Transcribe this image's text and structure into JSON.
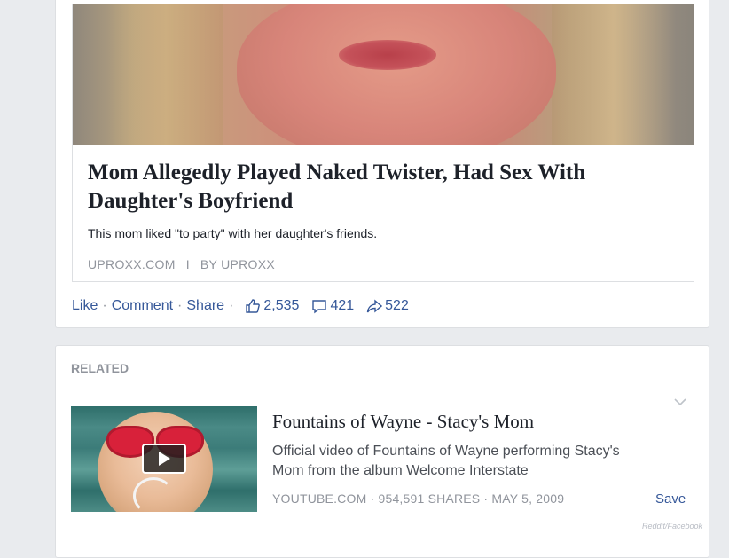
{
  "post": {
    "link_title": "Mom Allegedly Played Naked Twister, Had Sex With Daughter's Boyfriend",
    "link_description": "This mom liked \"to party\" with her daughter's friends.",
    "source_domain": "UPROXX.COM",
    "source_separator": "I",
    "source_author": "BY UPROXX",
    "actions": {
      "like_label": "Like",
      "comment_label": "Comment",
      "share_label": "Share",
      "separator": "·",
      "likes_count": "2,535",
      "comments_count": "421",
      "shares_count": "522"
    },
    "icons": {
      "like": "thumbs-up-icon",
      "comment": "comment-bubble-icon",
      "share": "share-arrow-icon"
    }
  },
  "related": {
    "header_label": "RELATED",
    "item": {
      "title": "Fountains of Wayne - Stacy's Mom",
      "description": "Official video of Fountains of Wayne performing Stacy's Mom from the album Welcome Interstate",
      "source_line": "YOUTUBE.COM · 954,591 SHARES · MAY 5, 2009",
      "save_label": "Save",
      "thumbnail_icon": "play-icon"
    },
    "options_icon": "chevron-down-icon"
  },
  "watermark": "Reddit/Facebook",
  "colors": {
    "link_blue": "#365899",
    "meta_gray": "#90949c",
    "text_dark": "#1d2129",
    "background": "#e9ebee"
  }
}
